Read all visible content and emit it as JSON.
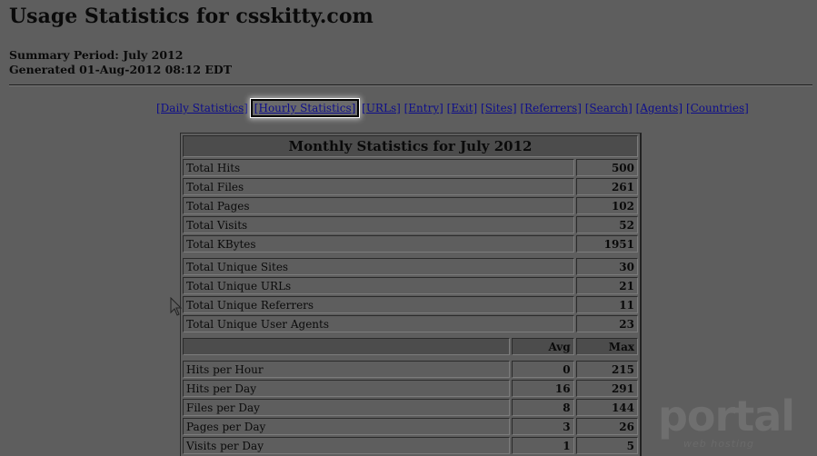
{
  "header": {
    "title": "Usage Statistics for csskitty.com",
    "summary_period": "Summary Period: July 2012",
    "generated": "Generated 01-Aug-2012 08:12 EDT"
  },
  "nav": {
    "daily": "[Daily Statistics]",
    "hourly": "[Hourly Statistics]",
    "urls": "[URLs]",
    "entry": "[Entry]",
    "exit": "[Exit]",
    "sites": "[Sites]",
    "referrers": "[Referrers]",
    "search": "[Search]",
    "agents": "[Agents]",
    "countries": "[Countries]"
  },
  "table": {
    "caption": "Monthly Statistics for July 2012",
    "totals": [
      {
        "label": "Total Hits",
        "value": "500"
      },
      {
        "label": "Total Files",
        "value": "261"
      },
      {
        "label": "Total Pages",
        "value": "102"
      },
      {
        "label": "Total Visits",
        "value": "52"
      },
      {
        "label": "Total KBytes",
        "value": "1951"
      }
    ],
    "uniques": [
      {
        "label": "Total Unique Sites",
        "value": "30"
      },
      {
        "label": "Total Unique URLs",
        "value": "21"
      },
      {
        "label": "Total Unique Referrers",
        "value": "11"
      },
      {
        "label": "Total Unique User Agents",
        "value": "23"
      }
    ],
    "avg_header": "Avg",
    "max_header": "Max",
    "rates": [
      {
        "label": "Hits per Hour",
        "avg": "0",
        "max": "215"
      },
      {
        "label": "Hits per Day",
        "avg": "16",
        "max": "291"
      },
      {
        "label": "Files per Day",
        "avg": "8",
        "max": "144"
      },
      {
        "label": "Pages per Day",
        "avg": "3",
        "max": "26"
      },
      {
        "label": "Visits per Day",
        "avg": "1",
        "max": "5"
      }
    ]
  },
  "watermark": {
    "brand": "portal",
    "sub": "web hosting"
  }
}
